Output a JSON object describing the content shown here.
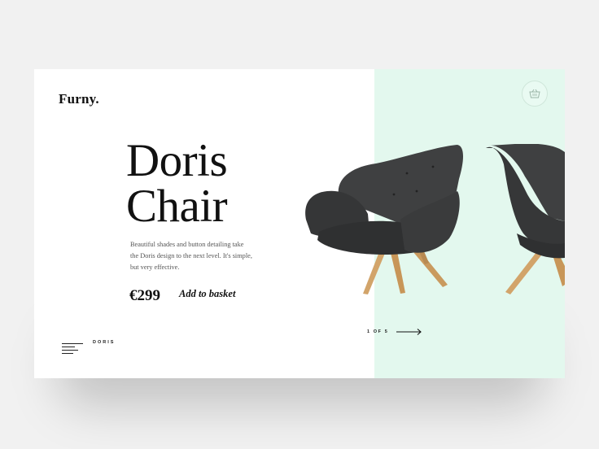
{
  "brand": {
    "logo": "Furny."
  },
  "product": {
    "title_line1": "Doris",
    "title_line2": "Chair",
    "description": "Beautiful shades and button detailing take the Doris design to the next level. It's simple, but very effective.",
    "price": "€299",
    "add_to_basket_label": "Add to basket"
  },
  "footer": {
    "menu_label": "DORIS",
    "pagination": "1 OF 5"
  },
  "icons": {
    "basket": "basket-icon",
    "menu": "menu-icon",
    "next": "arrow-right-icon"
  },
  "colors": {
    "background": "#f1f1f1",
    "card": "#ffffff",
    "mint_panel": "#e3f8ee",
    "text": "#111111",
    "chair_fabric": "#3a3b3c",
    "chair_legs": "#d2a46a"
  }
}
